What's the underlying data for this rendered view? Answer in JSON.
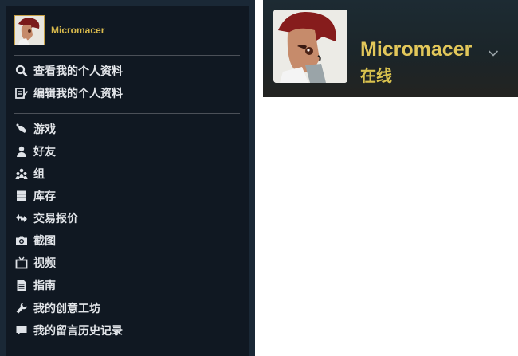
{
  "user": {
    "name": "Micromacer",
    "status": "在线"
  },
  "menu": {
    "profile_actions": [
      {
        "label": "查看我的个人资料",
        "icon": "search-icon"
      },
      {
        "label": "编辑我的个人资料",
        "icon": "edit-profile-icon"
      }
    ],
    "items": [
      {
        "label": "游戏",
        "icon": "game-icon"
      },
      {
        "label": "好友",
        "icon": "friend-icon"
      },
      {
        "label": "组",
        "icon": "group-icon"
      },
      {
        "label": "库存",
        "icon": "inventory-icon"
      },
      {
        "label": "交易报价",
        "icon": "trade-icon"
      },
      {
        "label": "截图",
        "icon": "camera-icon"
      },
      {
        "label": "视频",
        "icon": "tv-icon"
      },
      {
        "label": "指南",
        "icon": "guide-icon"
      },
      {
        "label": "我的创意工坊",
        "icon": "wrench-icon"
      },
      {
        "label": "我的留言历史记录",
        "icon": "comment-icon"
      }
    ]
  },
  "colors": {
    "menu_bg": "#101822",
    "accent_gold": "#d8b94c",
    "menu_text": "#e3e6ea"
  }
}
